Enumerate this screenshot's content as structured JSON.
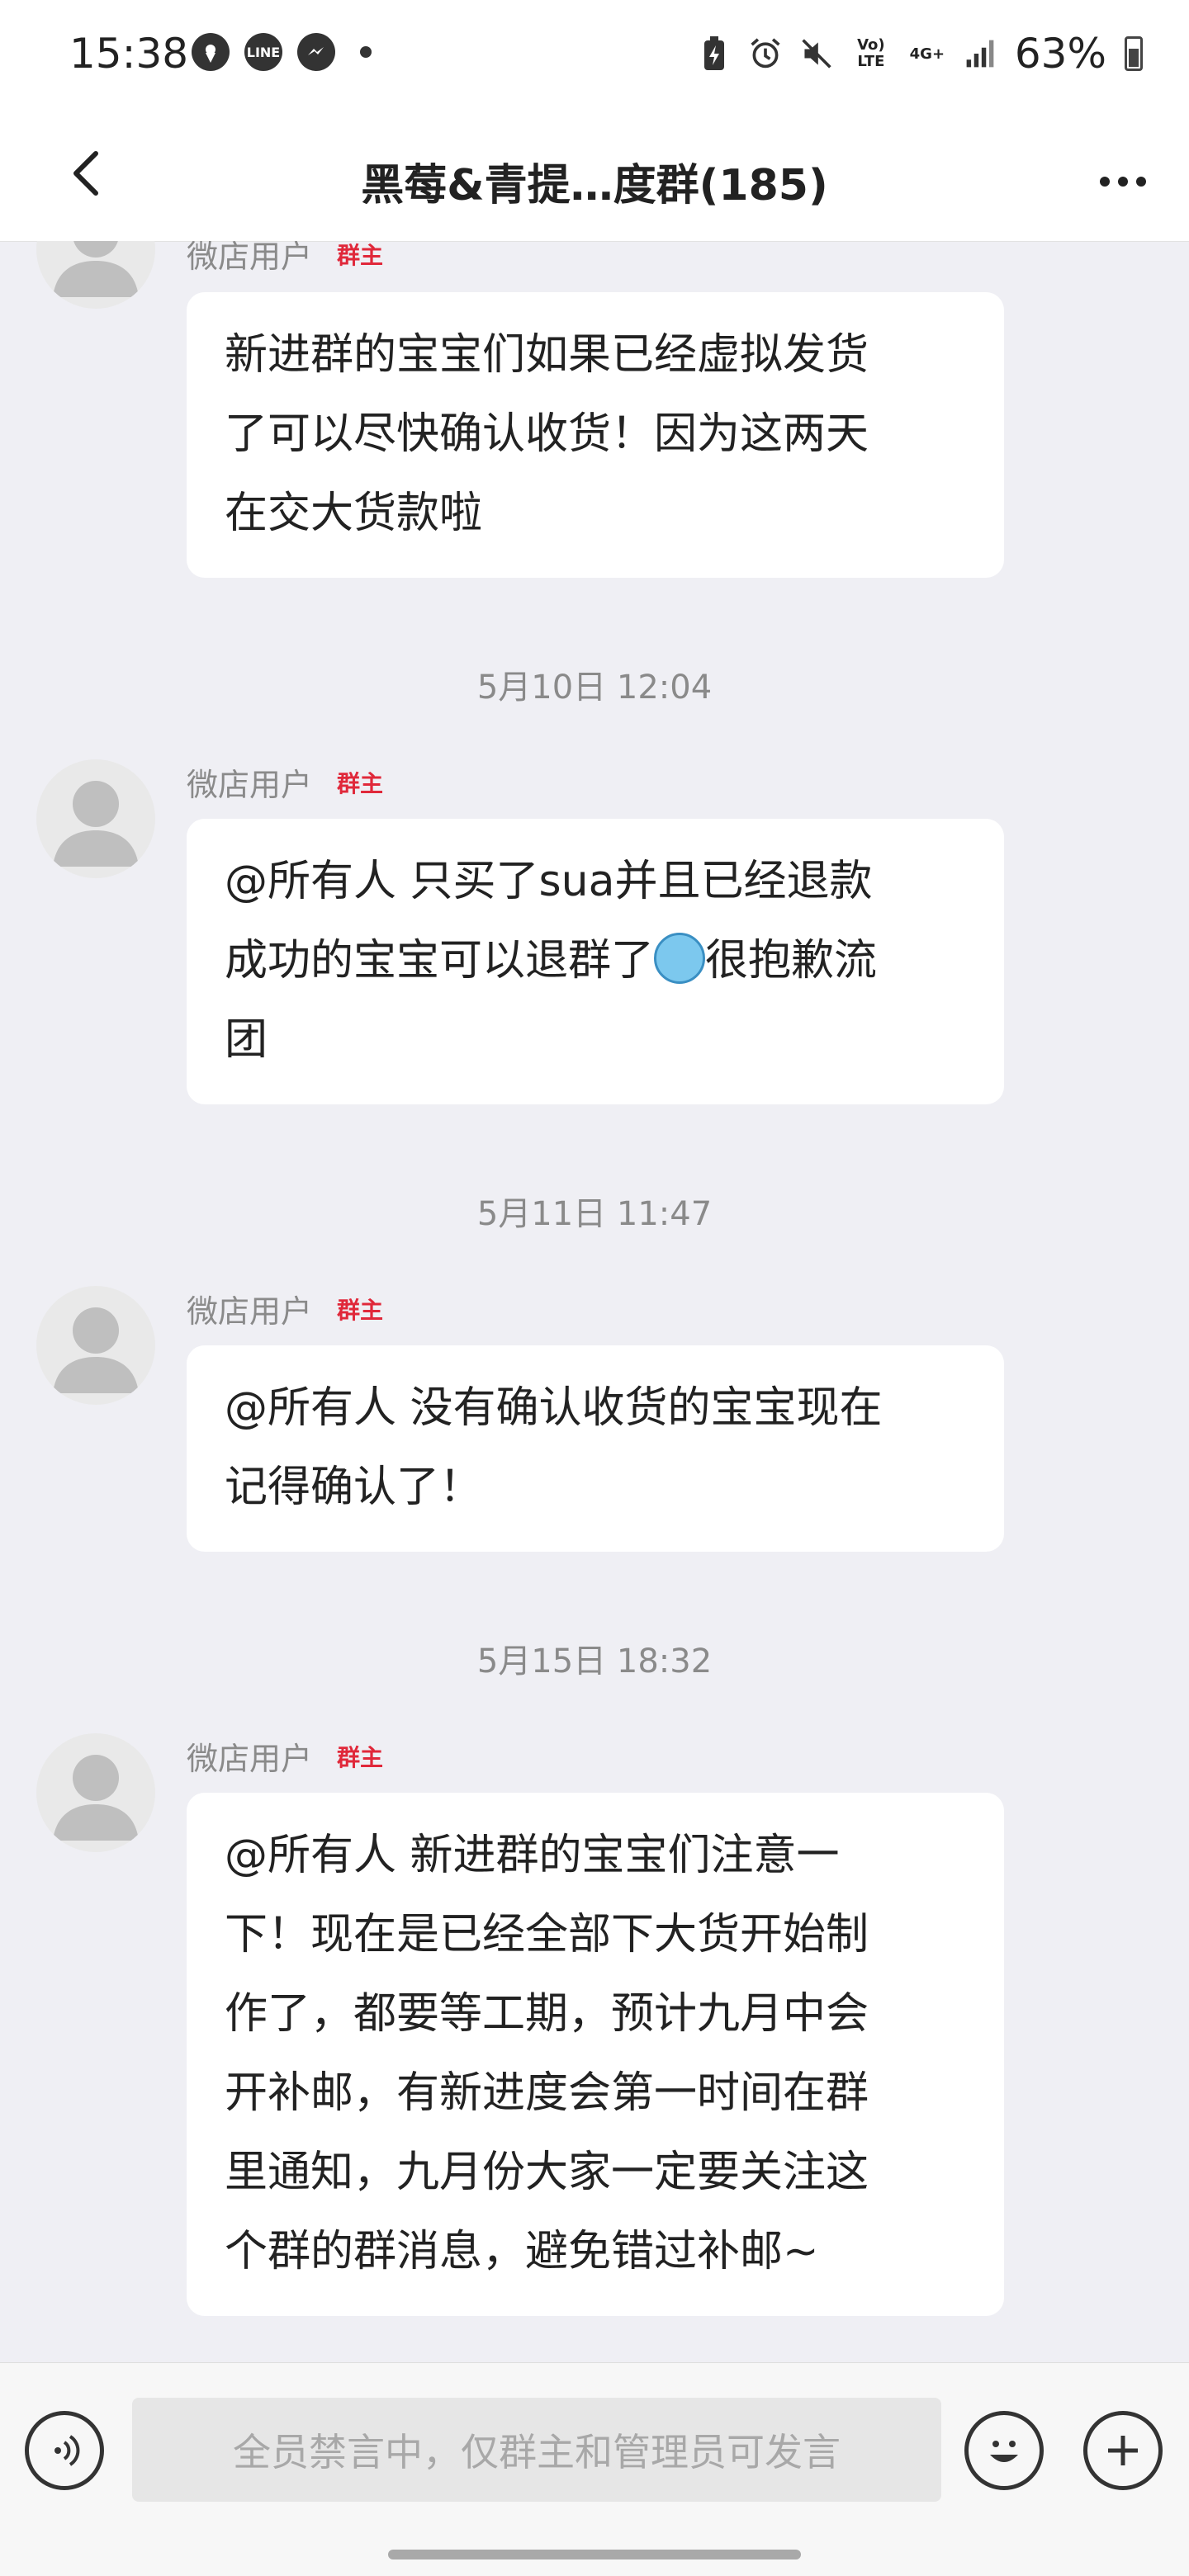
{
  "status_bar": {
    "time": "15:38",
    "notification_icons": [
      "location-icon",
      "line-icon",
      "messenger-icon"
    ],
    "battery_percent": "63%",
    "network_lte_label": "Vo) LTE",
    "network_4g_label": "4G+"
  },
  "header": {
    "title": "黑莓&青提…度群(185)"
  },
  "messages": [
    {
      "sender": "微店用户",
      "role_badge": "群主",
      "text": "新进群的宝宝们如果已经虚拟发货\n了可以尽快确认收货！因为这两天\n在交大货款啦"
    },
    {
      "timestamp": "5月10日 12:04",
      "sender": "微店用户",
      "role_badge": "群主",
      "text_part1": "@所有人 只买了sua并且已经退款\n成功的宝宝可以退群了",
      "emoji": "crying-face-emoji",
      "text_part2": "很抱歉流\n团"
    },
    {
      "timestamp": "5月11日 11:47",
      "sender": "微店用户",
      "role_badge": "群主",
      "text": "@所有人 没有确认收货的宝宝现在\n记得确认了！"
    },
    {
      "timestamp": "5月15日 18:32",
      "sender": "微店用户",
      "role_badge": "群主",
      "text": "@所有人 新进群的宝宝们注意一\n下！现在是已经全部下大货开始制\n作了，都要等工期，预计九月中会\n开补邮，有新进度会第一时间在群\n里通知，九月份大家一定要关注这\n个群的群消息，避免错过补邮~"
    }
  ],
  "input_bar": {
    "placeholder": "全员禁言中，仅群主和管理员可发言",
    "icons": [
      "voice-icon",
      "emoji-icon",
      "plus-icon"
    ]
  }
}
